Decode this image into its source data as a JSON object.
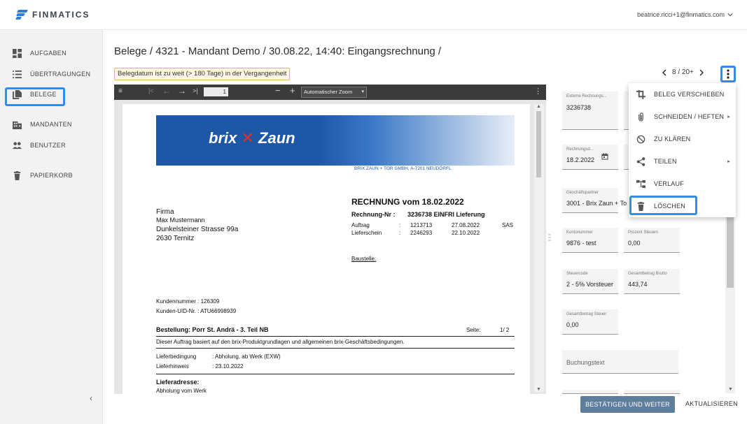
{
  "brand": {
    "name": "FINMATICS",
    "accent": "#2f8df0"
  },
  "user": {
    "email": "beatrice.ricci+1@finmatics.com"
  },
  "sidebar": {
    "items": [
      {
        "label": "AUFGABEN",
        "icon": "dashboard-icon"
      },
      {
        "label": "ÜBERTRAGUNGEN",
        "icon": "list-icon"
      },
      {
        "label": "BELEGE",
        "icon": "documents-icon"
      },
      {
        "label": "MANDANTEN",
        "icon": "building-icon"
      },
      {
        "label": "BENUTZER",
        "icon": "people-icon"
      },
      {
        "label": "PAPIERKORB",
        "icon": "trash-icon"
      }
    ],
    "active": "BELEGE",
    "collapse": "‹"
  },
  "header": {
    "title": "Belege / 4321 - Mandant Demo / 30.08.22, 14:40: Eingangsrechnung /",
    "warning": "Belegdatum ist zu weit (> 180 Tage) in der Vergangenheit"
  },
  "pager": {
    "text": "8 / 20+"
  },
  "viewer": {
    "page": "1",
    "zoom": "Automatischer Zoom",
    "document": {
      "logo_left": "brix",
      "logo_right": "Zaun",
      "company_line": "BRIX ZAUN + TOR GMBH, A-7201 NEUDÖRFL",
      "recipient": [
        "Firma",
        "Max Mustermann",
        "Dunkelsteiner Strasse 99a",
        "2630 Ternitz"
      ],
      "invoice_title": "RECHNUNG  vom  18.02.2022",
      "invoice_no_label": "Rechnung-Nr :",
      "invoice_no": "3236738 EINFRI Lieferung",
      "auftrag_label": "Auftrag",
      "auftrag_no": "1213713",
      "auftrag_date": "27.08.2022",
      "auftrag_code": "SAS",
      "lieferschein_label": "Lieferschein",
      "lieferschein_no": "2246293",
      "lieferschein_date": "22.10.2022",
      "baustelle": "Baustelle:",
      "kundennummer": "Kundennummer : 126309",
      "kunden_uid": "Kunden-UID-Nr. : ATU66998939",
      "bestellung": "Bestellung:  Porr St. Andrä - 3. Teil  NB",
      "seite_label": "Seite:",
      "seite_value": "1/  2",
      "terms_note": "Dieser Auftrag basiert auf den brix-Produktgrundlagen und allgemeinen brix-Geschäftsbedingungen.",
      "lieferbedingung_label": "Lieferbedingung",
      "lieferbedingung": ": Abholung,  ab Werk (EXW)",
      "lieferhinweis_label": "Lieferhinweis",
      "lieferhinweis": ": 23.10.2022",
      "lieferadresse": "Lieferadresse:",
      "lieferadresse_value": "Abholung vom Werk"
    }
  },
  "form": {
    "externe_label": "Externe Rechnungs...",
    "externe_value": "3236738",
    "rechnungsdatum_label": "Rechnungsd...",
    "rechnungsdatum_value": "18.2.2022",
    "partner_label": "Geschäftspartner",
    "partner_value": "3001 - Brix Zaun + To",
    "konto_label": "Kontonummer",
    "konto_value": "9876 - test",
    "prozent_label": "Prozent Steuern",
    "prozent_value": "0,00",
    "steuercode_label": "Steuercode",
    "steuercode_value": "2 - 5% Vorsteuer",
    "brutto_label": "Gesamtbetrag Brutto",
    "brutto_value": "443,74",
    "steuer_label": "Gesamtbetrag Steuer",
    "steuer_value": "0,00",
    "buchungstext_placeholder": "Buchungstext"
  },
  "menu": {
    "items": [
      {
        "label": "BELEG VERSCHIEBEN",
        "icon": "crop-icon"
      },
      {
        "label": "SCHNEIDEN / HEFTEN",
        "icon": "paperclip-icon",
        "submenu": true
      },
      {
        "label": "ZU KLÄREN",
        "icon": "block-icon"
      },
      {
        "label": "TEILEN",
        "icon": "share-icon",
        "submenu": true
      },
      {
        "label": "VERLAUF",
        "icon": "history-tree-icon"
      },
      {
        "label": "LÖSCHEN",
        "icon": "delete-icon"
      }
    ],
    "submenu_glyph": "▸"
  },
  "footer": {
    "confirm_label": "BESTÄTIGEN UND WEITER",
    "refresh_label": "AKTUALISIEREN"
  }
}
